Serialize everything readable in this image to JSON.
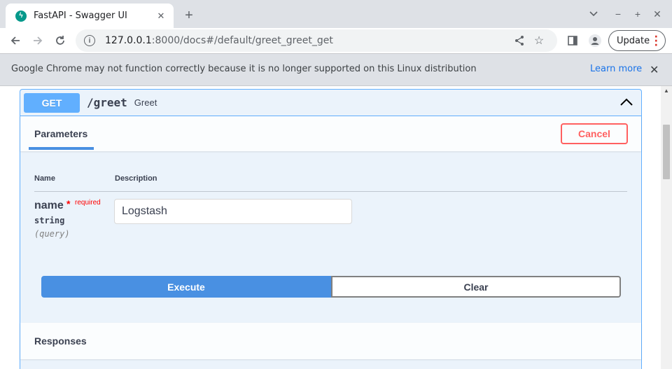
{
  "browser": {
    "tab_title": "FastAPI - Swagger UI",
    "url_host": "127.0.0.1",
    "url_rest": ":8000/docs#/default/greet_greet_get",
    "update_label": "Update",
    "infobar_message": "Google Chrome may not function correctly because it is no longer supported on this Linux distribution",
    "infobar_link": "Learn more"
  },
  "operation": {
    "method": "GET",
    "path": "/greet",
    "summary": "Greet",
    "colors": {
      "method": "#61affe",
      "cancel": "#ff6060",
      "execute": "#4990e2"
    }
  },
  "parameters": {
    "section_label": "Parameters",
    "cancel_label": "Cancel",
    "col_name": "Name",
    "col_description": "Description",
    "items": [
      {
        "name": "name",
        "required_mark": "*",
        "required_label": "required",
        "type": "string",
        "in": "(query)",
        "value": "Logstash"
      }
    ],
    "execute_label": "Execute",
    "clear_label": "Clear"
  },
  "responses": {
    "section_label": "Responses"
  }
}
